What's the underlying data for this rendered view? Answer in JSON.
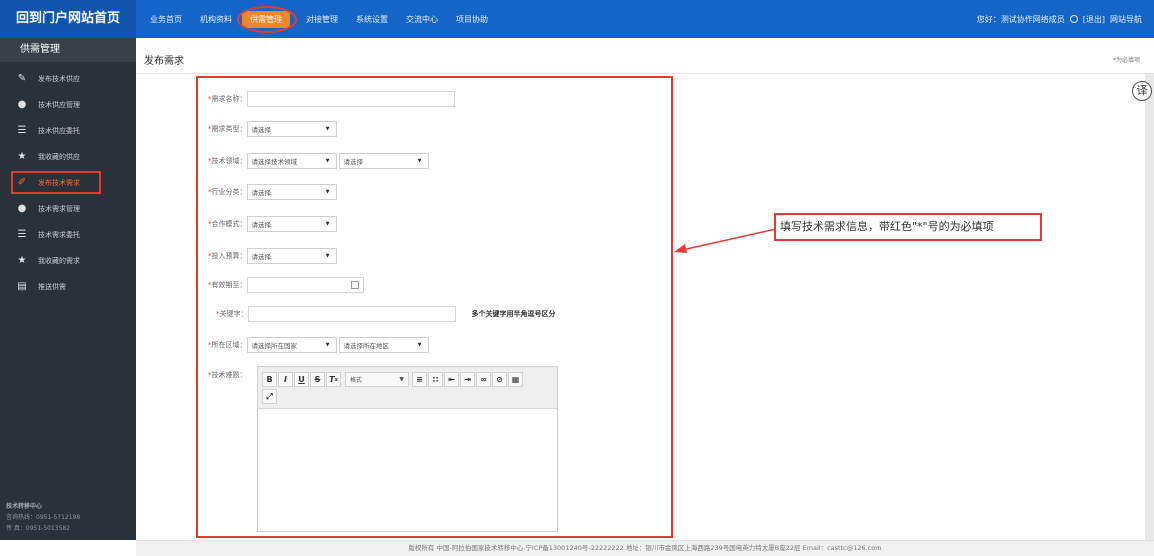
{
  "header": {
    "brand": "回到门户网站首页",
    "nav": [
      "业务首页",
      "机构资料",
      "供需管理",
      "对接管理",
      "系统设置",
      "交流中心",
      "项目协助"
    ],
    "active_nav": "供需管理",
    "greeting": "您好：测试协作网络成员",
    "logout": "[退出]",
    "site_nav": "网站导航"
  },
  "sidebar": {
    "title": "供需管理",
    "items": [
      {
        "label": "发布技术供应",
        "icon": "pencil-icon"
      },
      {
        "label": "技术供应管理",
        "icon": "circle-icon"
      },
      {
        "label": "技术供应委托",
        "icon": "list-icon"
      },
      {
        "label": "我收藏的供应",
        "icon": "star-icon"
      },
      {
        "label": "发布技术需求",
        "icon": "edit-icon"
      },
      {
        "label": "技术需求管理",
        "icon": "circle-icon"
      },
      {
        "label": "技术需求委托",
        "icon": "list-icon"
      },
      {
        "label": "我收藏的需求",
        "icon": "star-icon"
      },
      {
        "label": "推送供需",
        "icon": "document-icon"
      }
    ],
    "footer_title": "技术转移中心",
    "footer_line1": "咨询热线：0951-5712198",
    "footer_line2": "传 真：0951-5013582"
  },
  "page": {
    "title": "发布需求",
    "required_note": "*为必填项"
  },
  "form": {
    "demand_name_label": "需求名称：",
    "demand_type_label": "需求类型：",
    "tech_field_label": "技术领域：",
    "industry_label": "行业分类：",
    "coop_mode_label": "合作模式：",
    "budget_label": "投入预算：",
    "valid_until_label": "有效期至：",
    "keywords_label": "关键字：",
    "keywords_hint": "多个关键字用半角逗号区分",
    "region_label": "所在区域：",
    "tech_problem_label": "技术难题：",
    "select_placeholder": "请选择",
    "tech_field_placeholder": "请选择技术领域",
    "country_placeholder": "请选择所在国家",
    "area_placeholder": "请选择所在地区",
    "format_label": "格式"
  },
  "annotation": {
    "text": "填写技术需求信息，带红色\"*\"号的为必填项"
  },
  "translate_icon": "译",
  "footer": {
    "text": "版权所有 中国-阿拉伯国家技术转移中心 宁ICP备13001240号-22222222   地址：银川市金凤区上海西路239号国电英力特大厦B座22层 Email：casttc@126.com"
  }
}
